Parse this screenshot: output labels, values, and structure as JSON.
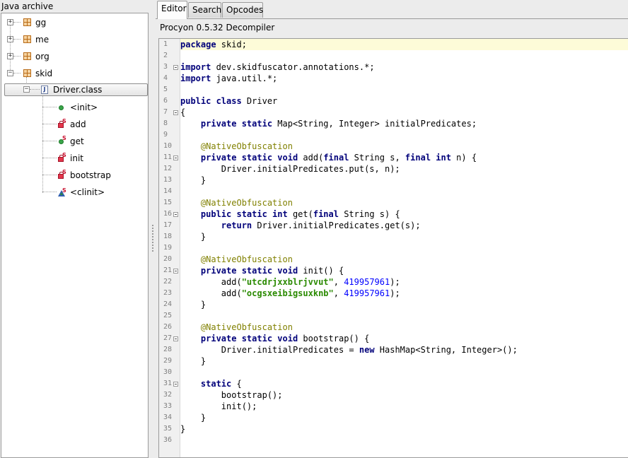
{
  "left_panel": {
    "title": "Java archive",
    "tree": {
      "packages": [
        {
          "label": "gg",
          "expanded": false
        },
        {
          "label": "me",
          "expanded": false
        },
        {
          "label": "org",
          "expanded": false
        },
        {
          "label": "skid",
          "expanded": true
        }
      ],
      "class_node": {
        "label": "Driver.class",
        "selected": true,
        "icon": "java-class-icon"
      },
      "members": [
        {
          "label": "<init>",
          "icon": "public-method-icon"
        },
        {
          "label": "add",
          "icon": "private-static-method-icon"
        },
        {
          "label": "get",
          "icon": "public-static-method-icon"
        },
        {
          "label": "init",
          "icon": "private-static-method-icon"
        },
        {
          "label": "bootstrap",
          "icon": "private-static-method-icon"
        },
        {
          "label": "<clinit>",
          "icon": "static-initializer-icon"
        }
      ]
    }
  },
  "tabs": [
    {
      "label": "Editor",
      "active": true
    },
    {
      "label": "Search",
      "active": false
    },
    {
      "label": "Opcodes",
      "active": false
    }
  ],
  "decompiler_label": "Procyon 0.5.32 Decompiler",
  "editor": {
    "current_line": 1,
    "fold_lines": [
      3,
      7,
      11,
      16,
      21,
      27,
      31
    ],
    "colors": {
      "keyword": "#00007a",
      "annotation": "#808000",
      "string": "#2a8a00",
      "number": "#0000ff",
      "current_line_bg": "#fdfbd8"
    },
    "lines": [
      {
        "n": "1",
        "tokens": [
          {
            "t": "kw",
            "v": "package"
          },
          {
            "t": "plain",
            "v": " skid;"
          }
        ]
      },
      {
        "n": "2",
        "tokens": []
      },
      {
        "n": "3",
        "tokens": [
          {
            "t": "kw",
            "v": "import"
          },
          {
            "t": "plain",
            "v": " dev.skidfuscator.annotations.*;"
          }
        ]
      },
      {
        "n": "4",
        "tokens": [
          {
            "t": "kw",
            "v": "import"
          },
          {
            "t": "plain",
            "v": " java.util.*;"
          }
        ]
      },
      {
        "n": "5",
        "tokens": []
      },
      {
        "n": "6",
        "tokens": [
          {
            "t": "kw",
            "v": "public class"
          },
          {
            "t": "plain",
            "v": " Driver"
          }
        ]
      },
      {
        "n": "7",
        "tokens": [
          {
            "t": "plain",
            "v": "{"
          }
        ]
      },
      {
        "n": "8",
        "tokens": [
          {
            "t": "plain",
            "v": "    "
          },
          {
            "t": "kw",
            "v": "private static"
          },
          {
            "t": "plain",
            "v": " Map<String, Integer> initialPredicates;"
          }
        ]
      },
      {
        "n": "9",
        "tokens": []
      },
      {
        "n": "10",
        "tokens": [
          {
            "t": "plain",
            "v": "    "
          },
          {
            "t": "ann",
            "v": "@NativeObfuscation"
          }
        ]
      },
      {
        "n": "11",
        "tokens": [
          {
            "t": "plain",
            "v": "    "
          },
          {
            "t": "kw",
            "v": "private static void"
          },
          {
            "t": "plain",
            "v": " add("
          },
          {
            "t": "kw",
            "v": "final"
          },
          {
            "t": "plain",
            "v": " String s, "
          },
          {
            "t": "kw",
            "v": "final int"
          },
          {
            "t": "plain",
            "v": " n) {"
          }
        ]
      },
      {
        "n": "12",
        "tokens": [
          {
            "t": "plain",
            "v": "        Driver.initialPredicates.put(s, n);"
          }
        ]
      },
      {
        "n": "13",
        "tokens": [
          {
            "t": "plain",
            "v": "    }"
          }
        ]
      },
      {
        "n": "14",
        "tokens": []
      },
      {
        "n": "15",
        "tokens": [
          {
            "t": "plain",
            "v": "    "
          },
          {
            "t": "ann",
            "v": "@NativeObfuscation"
          }
        ]
      },
      {
        "n": "16",
        "tokens": [
          {
            "t": "plain",
            "v": "    "
          },
          {
            "t": "kw",
            "v": "public static int"
          },
          {
            "t": "plain",
            "v": " get("
          },
          {
            "t": "kw",
            "v": "final"
          },
          {
            "t": "plain",
            "v": " String s) {"
          }
        ]
      },
      {
        "n": "17",
        "tokens": [
          {
            "t": "plain",
            "v": "        "
          },
          {
            "t": "kw",
            "v": "return"
          },
          {
            "t": "plain",
            "v": " Driver.initialPredicates.get(s);"
          }
        ]
      },
      {
        "n": "18",
        "tokens": [
          {
            "t": "plain",
            "v": "    }"
          }
        ]
      },
      {
        "n": "19",
        "tokens": []
      },
      {
        "n": "20",
        "tokens": [
          {
            "t": "plain",
            "v": "    "
          },
          {
            "t": "ann",
            "v": "@NativeObfuscation"
          }
        ]
      },
      {
        "n": "21",
        "tokens": [
          {
            "t": "plain",
            "v": "    "
          },
          {
            "t": "kw",
            "v": "private static void"
          },
          {
            "t": "plain",
            "v": " init() {"
          }
        ]
      },
      {
        "n": "22",
        "tokens": [
          {
            "t": "plain",
            "v": "        add("
          },
          {
            "t": "str",
            "v": "\"utcdrjxxblrjvvut\""
          },
          {
            "t": "plain",
            "v": ", "
          },
          {
            "t": "num",
            "v": "419957961"
          },
          {
            "t": "plain",
            "v": ");"
          }
        ]
      },
      {
        "n": "23",
        "tokens": [
          {
            "t": "plain",
            "v": "        add("
          },
          {
            "t": "str",
            "v": "\"ocgsxeibigsuxknb\""
          },
          {
            "t": "plain",
            "v": ", "
          },
          {
            "t": "num",
            "v": "419957961"
          },
          {
            "t": "plain",
            "v": ");"
          }
        ]
      },
      {
        "n": "24",
        "tokens": [
          {
            "t": "plain",
            "v": "    }"
          }
        ]
      },
      {
        "n": "25",
        "tokens": []
      },
      {
        "n": "26",
        "tokens": [
          {
            "t": "plain",
            "v": "    "
          },
          {
            "t": "ann",
            "v": "@NativeObfuscation"
          }
        ]
      },
      {
        "n": "27",
        "tokens": [
          {
            "t": "plain",
            "v": "    "
          },
          {
            "t": "kw",
            "v": "private static void"
          },
          {
            "t": "plain",
            "v": " bootstrap() {"
          }
        ]
      },
      {
        "n": "28",
        "tokens": [
          {
            "t": "plain",
            "v": "        Driver.initialPredicates = "
          },
          {
            "t": "kw",
            "v": "new"
          },
          {
            "t": "plain",
            "v": " HashMap<String, Integer>();"
          }
        ]
      },
      {
        "n": "29",
        "tokens": [
          {
            "t": "plain",
            "v": "    }"
          }
        ]
      },
      {
        "n": "30",
        "tokens": []
      },
      {
        "n": "31",
        "tokens": [
          {
            "t": "plain",
            "v": "    "
          },
          {
            "t": "kw",
            "v": "static"
          },
          {
            "t": "plain",
            "v": " {"
          }
        ]
      },
      {
        "n": "32",
        "tokens": [
          {
            "t": "plain",
            "v": "        bootstrap();"
          }
        ]
      },
      {
        "n": "33",
        "tokens": [
          {
            "t": "plain",
            "v": "        init();"
          }
        ]
      },
      {
        "n": "34",
        "tokens": [
          {
            "t": "plain",
            "v": "    }"
          }
        ]
      },
      {
        "n": "35",
        "tokens": [
          {
            "t": "plain",
            "v": "}"
          }
        ]
      },
      {
        "n": "36",
        "tokens": []
      }
    ]
  }
}
